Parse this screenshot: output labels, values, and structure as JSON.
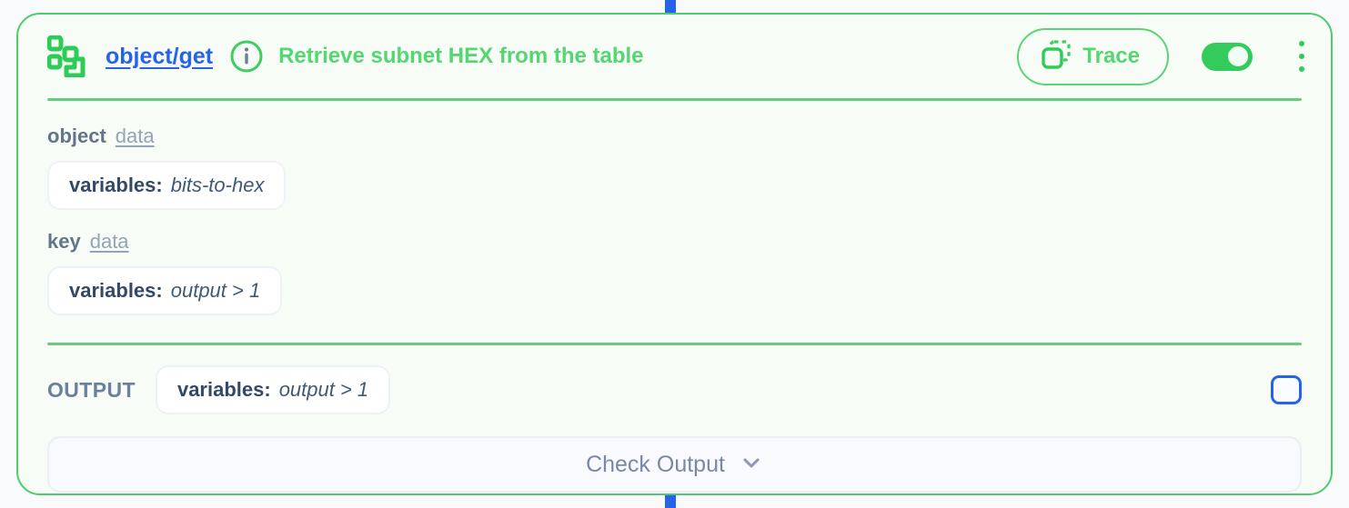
{
  "node": {
    "icon": "object-get-icon",
    "link_label": "object/get",
    "info_icon": "info-circle-icon",
    "title": "Retrieve subnet HEX from the table",
    "trace": {
      "icon": "trace-copy-icon",
      "label": "Trace"
    },
    "toggle": {
      "name": "node-enabled-toggle",
      "state": "on"
    },
    "menu_icon": "kebab-menu-icon"
  },
  "fields": [
    {
      "name": "object",
      "type": "data",
      "value_key": "variables:",
      "value": "bits-to-hex"
    },
    {
      "name": "key",
      "type": "data",
      "value_key": "variables:",
      "value": "output > 1"
    }
  ],
  "output": {
    "label": "OUTPUT",
    "value_key": "variables:",
    "value": "output > 1",
    "checkbox": "unchecked"
  },
  "footer": {
    "check_output_label": "Check Output",
    "chevron_icon": "chevron-down-icon"
  },
  "colors": {
    "accent_green": "#4ECB6E",
    "title_green": "#54D672",
    "link_blue": "#2563EB",
    "card_bg": "#F7FDF6",
    "canvas_bg": "#F8FAFC",
    "label_slate": "#64748B",
    "connector_blue": "#2563EB"
  }
}
